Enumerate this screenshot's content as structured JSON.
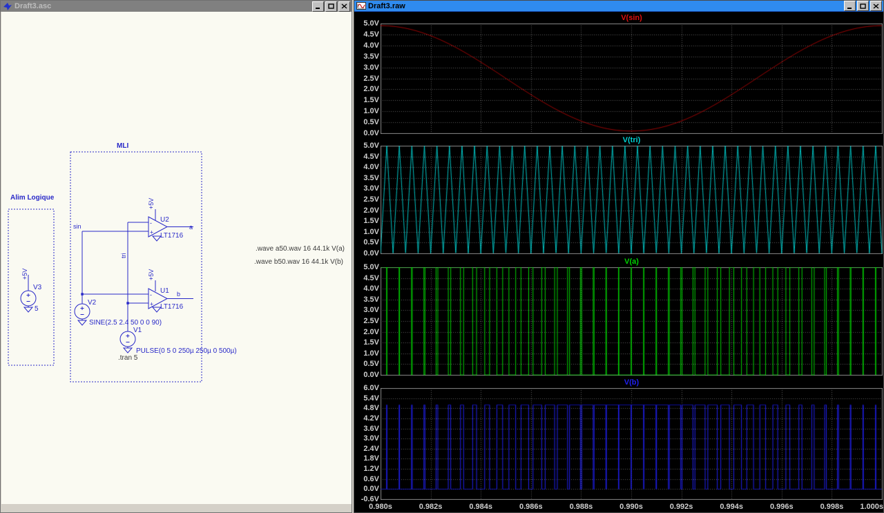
{
  "left_window": {
    "title": "Draft3.asc",
    "labels": {
      "alim": "Alim Logique",
      "mli": "MLI"
    },
    "nets": {
      "sin": "sin",
      "tri": "tri",
      "a": "a",
      "b": "b"
    },
    "components": {
      "v3": {
        "name": "V3",
        "value": "5",
        "rail": "+5V"
      },
      "v2": {
        "name": "V2",
        "value": "SINE(2.5 2.4 50 0 0 90)"
      },
      "v1": {
        "name": "V1",
        "value": "PULSE(0 5 0 250µ 250µ 0 500µ)"
      },
      "u2": {
        "name": "U2",
        "part": "LT1716",
        "rail": "+5V"
      },
      "u1": {
        "name": "U1",
        "part": "LT1716",
        "rail": "+5V"
      }
    },
    "directives": {
      "tran": ".tran 5",
      "wave_a": ".wave a50.wav 16 44.1k V(a)",
      "wave_b": ".wave b50.wav 16 44.1k V(b)"
    }
  },
  "right_window": {
    "title": "Draft3.raw"
  },
  "chart_data": {
    "type": "line",
    "x_label_unit": "s",
    "x_range": [
      0.98,
      1.0
    ],
    "x_ticks": [
      "0.980s",
      "0.982s",
      "0.984s",
      "0.986s",
      "0.988s",
      "0.990s",
      "0.992s",
      "0.994s",
      "0.996s",
      "0.998s",
      "1.000s"
    ],
    "grid": true,
    "background": "#000000",
    "grid_color": "#5f5f5f",
    "border_color": "#8a8a8a",
    "tick_label_color": "#cfcfcf",
    "signals": {
      "sine": {
        "offset": 2.5,
        "amplitude": 2.4,
        "freq_hz": 50,
        "phase_deg": 90
      },
      "triangle": {
        "low": 0,
        "high": 5,
        "period_s": 0.0005
      },
      "pwm": {
        "low": 0,
        "high": 5
      }
    },
    "panes": [
      {
        "title": "V(sin)",
        "color": "#e01010",
        "signal": "sine",
        "y_range": [
          0,
          5
        ],
        "y_ticks": [
          "5.0V",
          "4.5V",
          "4.0V",
          "3.5V",
          "3.0V",
          "2.5V",
          "2.0V",
          "1.5V",
          "1.0V",
          "0.5V",
          "0.0V"
        ]
      },
      {
        "title": "V(tri)",
        "color": "#00d2d2",
        "signal": "triangle",
        "y_range": [
          0,
          5
        ],
        "y_ticks": [
          "5.0V",
          "4.5V",
          "4.0V",
          "3.5V",
          "3.0V",
          "2.5V",
          "2.0V",
          "1.5V",
          "1.0V",
          "0.5V",
          "0.0V"
        ]
      },
      {
        "title": "V(a)",
        "color": "#00d400",
        "signal": "pwm_a",
        "y_range": [
          0,
          5
        ],
        "y_ticks": [
          "5.0V",
          "4.5V",
          "4.0V",
          "3.5V",
          "3.0V",
          "2.5V",
          "2.0V",
          "1.5V",
          "1.0V",
          "0.5V",
          "0.0V"
        ]
      },
      {
        "title": "V(b)",
        "color": "#2020f0",
        "signal": "pwm_b",
        "y_range": [
          -0.6,
          6.0
        ],
        "y_ticks": [
          "6.0V",
          "5.4V",
          "4.8V",
          "4.2V",
          "3.6V",
          "3.0V",
          "2.4V",
          "1.8V",
          "1.2V",
          "0.6V",
          "0.0V",
          "-0.6V"
        ]
      }
    ]
  }
}
